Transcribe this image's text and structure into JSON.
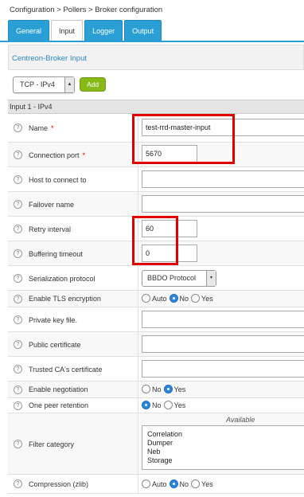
{
  "breadcrumb": "Configuration  >  Pollers  >  Broker configuration",
  "tabs": [
    {
      "label": "General",
      "active": false
    },
    {
      "label": "Input",
      "active": true
    },
    {
      "label": "Logger",
      "active": false
    },
    {
      "label": "Output",
      "active": false
    }
  ],
  "section_title": "Centreon-Broker Input",
  "type_select": {
    "value": "TCP - IPv4"
  },
  "add_button": "Add",
  "subsection_title": "Input 1 - IPv4",
  "help_glyph": "?",
  "required_mark": "*",
  "fields": {
    "name": {
      "label": "Name",
      "value": "test-rrd-master-input"
    },
    "port": {
      "label": "Connection port",
      "value": "5670"
    },
    "host": {
      "label": "Host to connect to",
      "value": ""
    },
    "failover": {
      "label": "Failover name",
      "value": ""
    },
    "retry": {
      "label": "Retry interval",
      "value": "60"
    },
    "buffering": {
      "label": "Buffering timeout",
      "value": "0"
    },
    "serialization": {
      "label": "Serialization protocol",
      "value": "BBDO Protocol"
    },
    "tls": {
      "label": "Enable TLS encryption",
      "options": [
        "Auto",
        "No",
        "Yes"
      ],
      "selected": "No"
    },
    "private_key": {
      "label": "Private key file.",
      "value": ""
    },
    "public_cert": {
      "label": "Public certificate",
      "value": ""
    },
    "ca_cert": {
      "label": "Trusted CA's certificate",
      "value": ""
    },
    "negotiation": {
      "label": "Enable negotiation",
      "options": [
        "No",
        "Yes"
      ],
      "selected": "Yes"
    },
    "one_peer": {
      "label": "One peer retention",
      "options": [
        "No",
        "Yes"
      ],
      "selected": "No"
    },
    "filter": {
      "label": "Filter category",
      "available_label": "Available",
      "items": [
        "Correlation",
        "Dumper",
        "Neb",
        "Storage"
      ]
    },
    "compression": {
      "label": "Compression (zlib)",
      "options": [
        "Auto",
        "No",
        "Yes"
      ],
      "selected": "No"
    }
  },
  "colors": {
    "tab_blue": "#2a9fd6",
    "add_green": "#88b917",
    "highlight_red": "#e10000",
    "radio_blue": "#2a85e0"
  }
}
